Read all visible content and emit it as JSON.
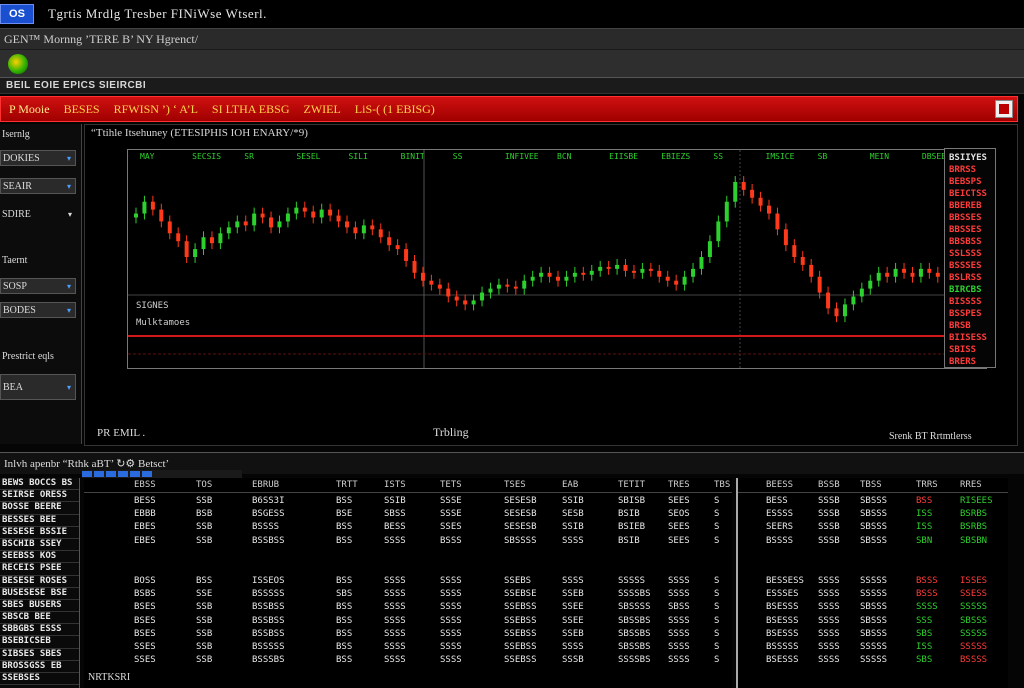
{
  "window": {
    "badge": "OS",
    "title": "Tgrtis  Mrdlg  Tresber  FINiWse  Wtserl."
  },
  "toolbar": {
    "text": "GEN™ Mornng  ’TERE  B’  NY  Hgrenct/"
  },
  "menubar": {
    "text": "BEIL  EOIE  EPICS  SIEIRCBI"
  },
  "redbar": {
    "tabs": [
      "P  Mooie",
      "BESES",
      "RFWISN  ’)  ‘ A’L",
      "SI  LTHA  EBSG",
      "ZWIEL",
      "LiS-(  (1  EBISG)"
    ]
  },
  "leftpanel": {
    "heading": "Isernlg",
    "items": [
      {
        "label": "DOKIES",
        "type": "box",
        "arrow": "▾"
      },
      {
        "label": "SEAIR",
        "type": "box",
        "arrow": "▾"
      },
      {
        "label": "SDIRE",
        "type": "plain-arrow",
        "arrow": "▾"
      },
      {
        "label": "Taernt",
        "type": "text"
      },
      {
        "label": "SOSP",
        "type": "box",
        "arrow": "▾"
      },
      {
        "label": "BODES",
        "type": "box",
        "arrow": "▾"
      },
      {
        "label": "Prestrict  eqls",
        "type": "text"
      },
      {
        "label": "BEA",
        "type": "box",
        "arrow": "▾"
      }
    ]
  },
  "chart_panel": {
    "title": "“Ttihle Itsehuney  (ETESIPHIS  IOH  ENARY/*9)",
    "footer_left": "PR  EMIL .",
    "footer_mid": "Trbling",
    "footer_right": "Srenk   BT   Rrtmtlerss",
    "series_labels": [
      "SIGNES",
      "Mulktamoes"
    ]
  },
  "chart_data": {
    "type": "candlestick",
    "title": "",
    "price_line_color": "#d01a1a",
    "up_color": "#2dd12d",
    "down_color": "#ff3a1a",
    "header_ticks": [
      "MAY",
      "SECSIS",
      "SR",
      "SESEL",
      "SILI",
      "BINIT",
      "SS",
      "INFIVEE",
      "BCN",
      "EIISBE",
      "EBIEZS",
      "SS",
      "IMSICE",
      "SB",
      "MEIN",
      "DBSEE"
    ],
    "closes": [
      62,
      68,
      64,
      58,
      52,
      48,
      40,
      44,
      50,
      47,
      52,
      55,
      58,
      56,
      62,
      60,
      55,
      58,
      62,
      65,
      63,
      60,
      64,
      61,
      58,
      55,
      52,
      56,
      54,
      50,
      46,
      44,
      38,
      32,
      28,
      26,
      24,
      20,
      18,
      16,
      18,
      22,
      24,
      26,
      25,
      24,
      28,
      30,
      32,
      30,
      28,
      30,
      32,
      31,
      33,
      35,
      34,
      36,
      33,
      32,
      34,
      33,
      30,
      28,
      26,
      30,
      34,
      40,
      48,
      58,
      68,
      78,
      74,
      70,
      66,
      62,
      54,
      46,
      40,
      36,
      30,
      22,
      14,
      10,
      16,
      20,
      24,
      28,
      32,
      30,
      34,
      32,
      30,
      34,
      32,
      30,
      32,
      34,
      30,
      28
    ]
  },
  "right_quotes": [
    {
      "t": "BSIIYES",
      "c": "w"
    },
    {
      "t": "BRRSS",
      "c": "r"
    },
    {
      "t": "BEBSPS",
      "c": "r"
    },
    {
      "t": "BEICTSS",
      "c": "r"
    },
    {
      "t": "BBEREB",
      "c": "r"
    },
    {
      "t": "BBSSES",
      "c": "r"
    },
    {
      "t": "BBSSES",
      "c": "r"
    },
    {
      "t": "BBSBSS",
      "c": "r"
    },
    {
      "t": "SSLSSS",
      "c": "r"
    },
    {
      "t": "BSSSES",
      "c": "r"
    },
    {
      "t": "BSLRSS",
      "c": "r"
    },
    {
      "t": "BIRCBS",
      "c": "g"
    },
    {
      "t": "BISSSS",
      "c": "r"
    },
    {
      "t": "BSSPES",
      "c": "r"
    },
    {
      "t": "BRSB",
      "c": "r"
    },
    {
      "t": "BIISESS",
      "c": "r"
    },
    {
      "t": "SBISS",
      "c": "r"
    },
    {
      "t": "BRERS",
      "c": "r"
    }
  ],
  "bottom": {
    "header": "Inlvh  apenbr  “Rthk  aBT’  ↻⚙  Betsct’",
    "footer": "NRTKSRI",
    "left_list": [
      "BEWS  BOCCS  BS",
      "SEIRSE  ORESS",
      "BOSSE  BEERE",
      "BESSES  BEE",
      "SESESE  BSSIE",
      "BSCHIB  SSEY",
      "SEEBSS  KOS",
      "RECEIS  PSEE",
      "BESESE  ROSES",
      "BUSESESE  BSE",
      "SBES  BUSERS",
      "SBSCB  BEE",
      "SBBGBS  ESSS",
      "BSEBICSEB",
      "SIBSES  SBES",
      "BROSSGSS  EB",
      "SSEBSES"
    ],
    "main_headers": [
      "EBSS",
      "TOS",
      "EBRUB",
      "TRTT",
      "ISTS",
      "TETS",
      "TSES",
      "EAB",
      "TETIT",
      "TRES",
      "TBS"
    ],
    "main_rows": [
      [
        "BESS",
        "SSB",
        "B6SS3I",
        "BSS",
        "SSIB",
        "SSSE",
        "SESESB",
        "SSIB",
        "SBISB",
        "SEES",
        "S"
      ],
      [
        "EBBB",
        "BSB",
        "BSGESS",
        "BSE",
        "SBSS",
        "SSSE",
        "SESESB",
        "SESB",
        "BSIB",
        "SEOS",
        "S"
      ],
      [
        "EBES",
        "SSB",
        "BSSSS",
        "BSS",
        "BESS",
        "SSES",
        "SESESB",
        "SSIB",
        "BSIEB",
        "SEES",
        "S"
      ],
      [
        "EBES",
        "SSB",
        "BSSBSS",
        "BSS",
        "SSSS",
        "BSSS",
        "SBSSSS",
        "SSSS",
        "BSIB",
        "SEES",
        "S"
      ],
      [
        "",
        "",
        "",
        "",
        "",
        "",
        "",
        "",
        "",
        "",
        ""
      ],
      [
        "BOSS",
        "BSS",
        "ISSEOS",
        "BSS",
        "SSSS",
        "SSSS",
        "SSEBS",
        "SSSS",
        "SSSSS",
        "SSSS",
        "S"
      ],
      [
        "BSBS",
        "SSE",
        "BSSSSS",
        "SBS",
        "SSSS",
        "SSSS",
        "SSEBSE",
        "SSEB",
        "SSSSBS",
        "SSSS",
        "S"
      ],
      [
        "BSES",
        "SSB",
        "BSSBSS",
        "BSS",
        "SSSS",
        "SSSS",
        "SSEBSS",
        "SSEE",
        "SBSSSS",
        "SBSS",
        "S"
      ],
      [
        "BSES",
        "SSB",
        "BSSBSS",
        "BSS",
        "SSSS",
        "SSSS",
        "SSEBSS",
        "SSEE",
        "SBSSBS",
        "SSSS",
        "S"
      ],
      [
        "BSES",
        "SSB",
        "BSSBSS",
        "BSS",
        "SSSS",
        "SSSS",
        "SSEBSS",
        "SSEB",
        "SBSSBS",
        "SSSS",
        "S"
      ],
      [
        "SSES",
        "SSB",
        "BSSSSS",
        "BSS",
        "SSSS",
        "SSSS",
        "SSEBSS",
        "SSSS",
        "SBSSBS",
        "SSSS",
        "S"
      ],
      [
        "SSES",
        "SSB",
        "BSSSBS",
        "BSS",
        "SSSS",
        "SSSS",
        "SSEBSS",
        "SSSB",
        "SSSSBS",
        "SSSS",
        "S"
      ]
    ],
    "side_headers": [
      "BEESS",
      "BSSB",
      "TBSS",
      "TRRS",
      "RRES"
    ],
    "side_rows": [
      [
        {
          "t": "BESS",
          "c": ""
        },
        {
          "t": "SSSB",
          "c": ""
        },
        {
          "t": "SBSSS",
          "c": ""
        },
        {
          "t": "BSS",
          "c": "r"
        },
        {
          "t": "RISEES",
          "c": "g"
        }
      ],
      [
        {
          "t": "ESSSS",
          "c": ""
        },
        {
          "t": "SSSB",
          "c": ""
        },
        {
          "t": "SBSSS",
          "c": ""
        },
        {
          "t": "ISS",
          "c": "g"
        },
        {
          "t": "BSRBS",
          "c": "g"
        }
      ],
      [
        {
          "t": "SEERS",
          "c": ""
        },
        {
          "t": "SSSB",
          "c": ""
        },
        {
          "t": "SBSSS",
          "c": ""
        },
        {
          "t": "ISS",
          "c": "g"
        },
        {
          "t": "BSRBS",
          "c": "g"
        }
      ],
      [
        {
          "t": "BSSSS",
          "c": ""
        },
        {
          "t": "SSSB",
          "c": ""
        },
        {
          "t": "SBSSS",
          "c": ""
        },
        {
          "t": "SBN",
          "c": "g"
        },
        {
          "t": "SBSBN",
          "c": "g"
        }
      ],
      [
        {
          "t": "",
          "c": ""
        },
        {
          "t": "",
          "c": ""
        },
        {
          "t": "",
          "c": ""
        },
        {
          "t": "",
          "c": ""
        },
        {
          "t": "",
          "c": ""
        }
      ],
      [
        {
          "t": "BESSESS",
          "c": ""
        },
        {
          "t": "SSSS",
          "c": ""
        },
        {
          "t": "SSSSS",
          "c": ""
        },
        {
          "t": "BSSS",
          "c": "r"
        },
        {
          "t": "ISSES",
          "c": "r"
        }
      ],
      [
        {
          "t": "ESSSES",
          "c": ""
        },
        {
          "t": "SSSS",
          "c": ""
        },
        {
          "t": "SSSSS",
          "c": ""
        },
        {
          "t": "BSSS",
          "c": "r"
        },
        {
          "t": "SSESS",
          "c": "r"
        }
      ],
      [
        {
          "t": "BSESSS",
          "c": ""
        },
        {
          "t": "SSSS",
          "c": ""
        },
        {
          "t": "SBSSS",
          "c": ""
        },
        {
          "t": "SSSS",
          "c": "g"
        },
        {
          "t": "SSSSS",
          "c": "g"
        }
      ],
      [
        {
          "t": "BSESSS",
          "c": ""
        },
        {
          "t": "SSSS",
          "c": ""
        },
        {
          "t": "SBSSS",
          "c": ""
        },
        {
          "t": "SSS",
          "c": "g"
        },
        {
          "t": "SBSSS",
          "c": "g"
        }
      ],
      [
        {
          "t": "BSESSS",
          "c": ""
        },
        {
          "t": "SSSS",
          "c": ""
        },
        {
          "t": "SBSSS",
          "c": ""
        },
        {
          "t": "SBS",
          "c": "g"
        },
        {
          "t": "SSSSS",
          "c": "g"
        }
      ],
      [
        {
          "t": "BSSSSS",
          "c": ""
        },
        {
          "t": "SSSS",
          "c": ""
        },
        {
          "t": "SSSSS",
          "c": ""
        },
        {
          "t": "ISS",
          "c": "g"
        },
        {
          "t": "SSSSS",
          "c": "r"
        }
      ],
      [
        {
          "t": "BSESSS",
          "c": ""
        },
        {
          "t": "SSSS",
          "c": ""
        },
        {
          "t": "SSSSS",
          "c": ""
        },
        {
          "t": "SBS",
          "c": "g"
        },
        {
          "t": "BSSSS",
          "c": "r"
        }
      ]
    ]
  }
}
